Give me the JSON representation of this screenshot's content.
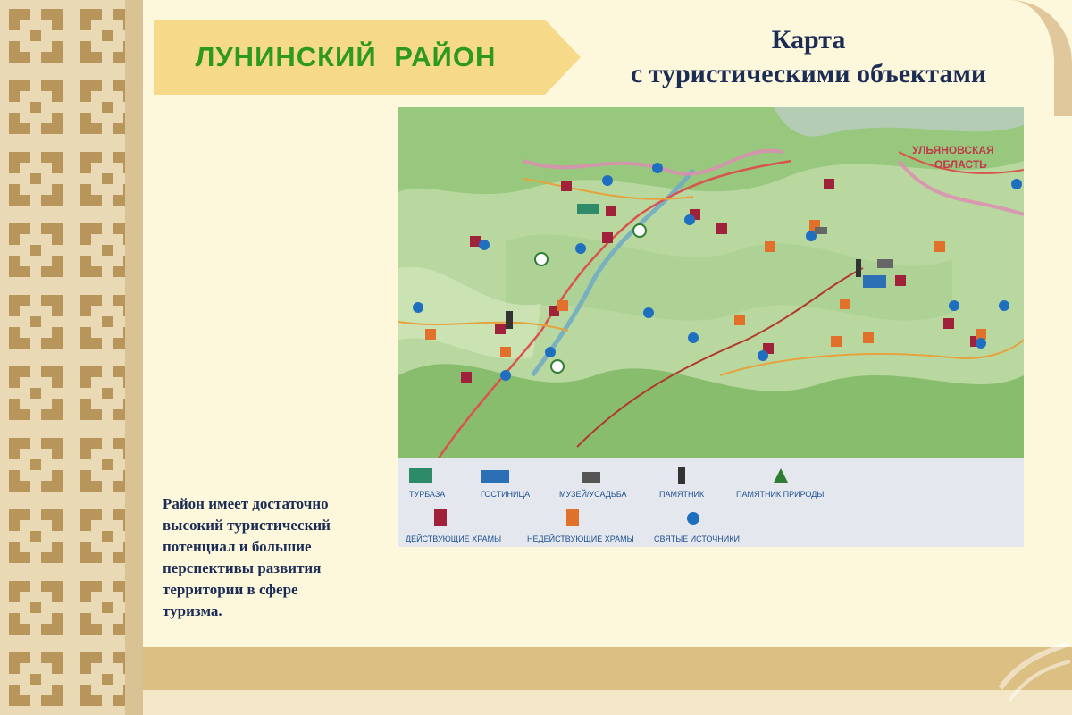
{
  "header": {
    "district_title": "ЛУНИНСКИЙ   РАЙОН",
    "map_title_line1": "Карта",
    "map_title_line2": "с туристическими объектами"
  },
  "description": [
    "Район имеет достаточно",
    "высокий туристический",
    "потенциал и большие",
    "перспективы развития",
    "территории в сфере",
    "туризма."
  ],
  "map": {
    "region_label_line1": "УЛЬЯНОВСКАЯ",
    "region_label_line2": "ОБЛАСТЬ",
    "legend": {
      "turbaza": "ТУРБАЗА",
      "hotel": "ГОСТИНИЦА",
      "museum": "МУЗЕЙ/УСАДЬБА",
      "monument": "ПАМЯТНИК",
      "nature_monument": "ПАМЯТНИК ПРИРОДЫ",
      "active_temples": "ДЕЙСТВУЮЩИЕ ХРАМЫ",
      "inactive_temples": "НЕДЕЙСТВУЮЩИЕ ХРАМЫ",
      "holy_springs": "СВЯТЫЕ ИСТОЧНИКИ"
    },
    "colors": {
      "turbaza": "#2e8b6a",
      "hotel": "#2d6fb4",
      "museum": "#555555",
      "monument": "#333333",
      "nature_monument": "#2e7d32",
      "active_temple": "#a0213a",
      "inactive_temple": "#e0702a",
      "holy_spring": "#1f6fc0"
    }
  },
  "theme": {
    "title_green": "#2d9a1f",
    "heading_navy": "#1c2d55",
    "arrow_fill": "#f7d98a"
  }
}
